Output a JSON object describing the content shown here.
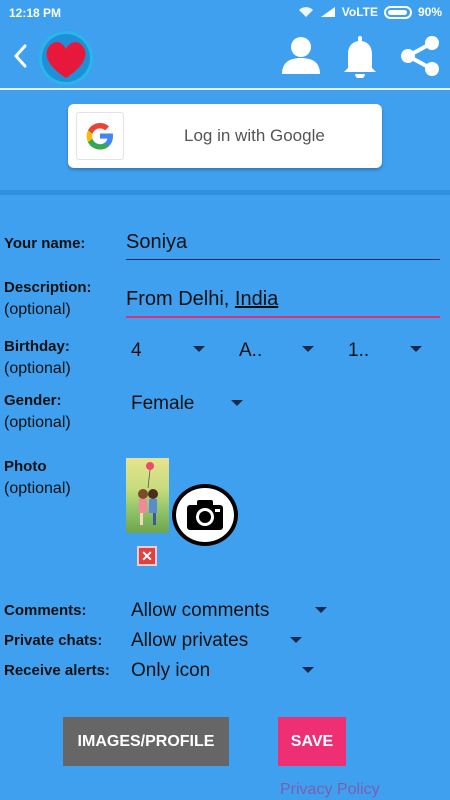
{
  "status_bar": {
    "time": "12:18 PM",
    "network": "VoLTE",
    "battery": "90%"
  },
  "app_bar": {
    "icons": [
      "back-arrow-icon",
      "heart-logo",
      "user-icon",
      "bell-icon",
      "share-icon"
    ]
  },
  "login": {
    "google_label": "Log in with Google"
  },
  "form": {
    "name": {
      "label": "Your name:",
      "value": "Soniya"
    },
    "description": {
      "label": "Description:",
      "optional": "(optional)",
      "value": "From Delhi, India"
    },
    "birthday": {
      "label": "Birthday:",
      "optional": "(optional)",
      "day": "4",
      "month": "A..",
      "year": "1.."
    },
    "gender": {
      "label": "Gender:",
      "optional": "(optional)",
      "value": "Female"
    },
    "photo": {
      "label": "Photo",
      "optional": "(optional)"
    },
    "comments": {
      "label": "Comments:",
      "value": "Allow comments"
    },
    "private_chats": {
      "label": "Private chats:",
      "value": "Allow privates"
    },
    "alerts": {
      "label": "Receive alerts:",
      "value": "Only icon"
    }
  },
  "actions": {
    "images_profile": "IMAGES/PROFILE",
    "save": "SAVE",
    "privacy": "Privacy Policy"
  },
  "colors": {
    "background": "#3fa0ef",
    "save": "#ef2f74",
    "images_btn": "#666666",
    "link": "#7a5fb0"
  }
}
